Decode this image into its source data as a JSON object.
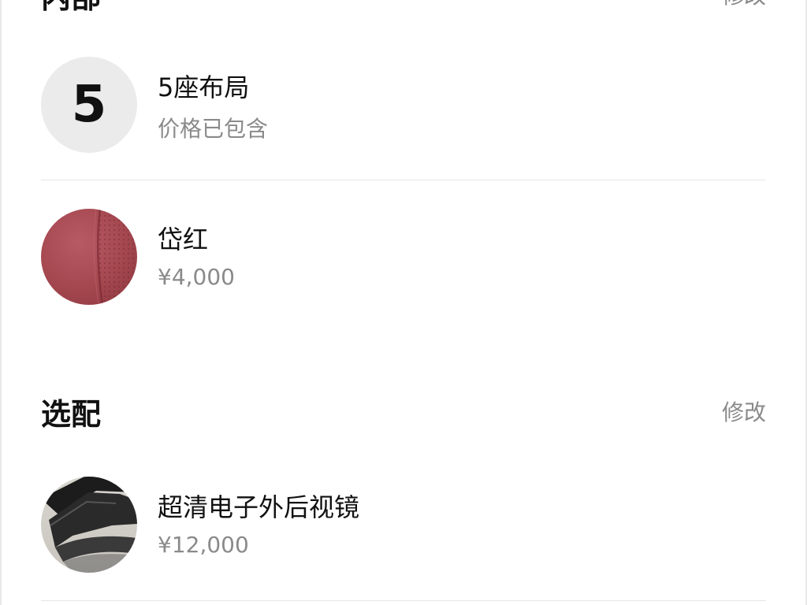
{
  "interior_section": {
    "title": "内部",
    "edit_label": "修改"
  },
  "interior_items": [
    {
      "thumb_text": "5",
      "name": "5座布局",
      "sub": "价格已包含"
    },
    {
      "name": "岱红",
      "sub": "¥4,000",
      "swatch_color": "#a4474f"
    }
  ],
  "options_section": {
    "title": "选配",
    "edit_label": "修改"
  },
  "option_items": [
    {
      "name": "超清电子外后视镜",
      "sub": "¥12,000"
    }
  ]
}
